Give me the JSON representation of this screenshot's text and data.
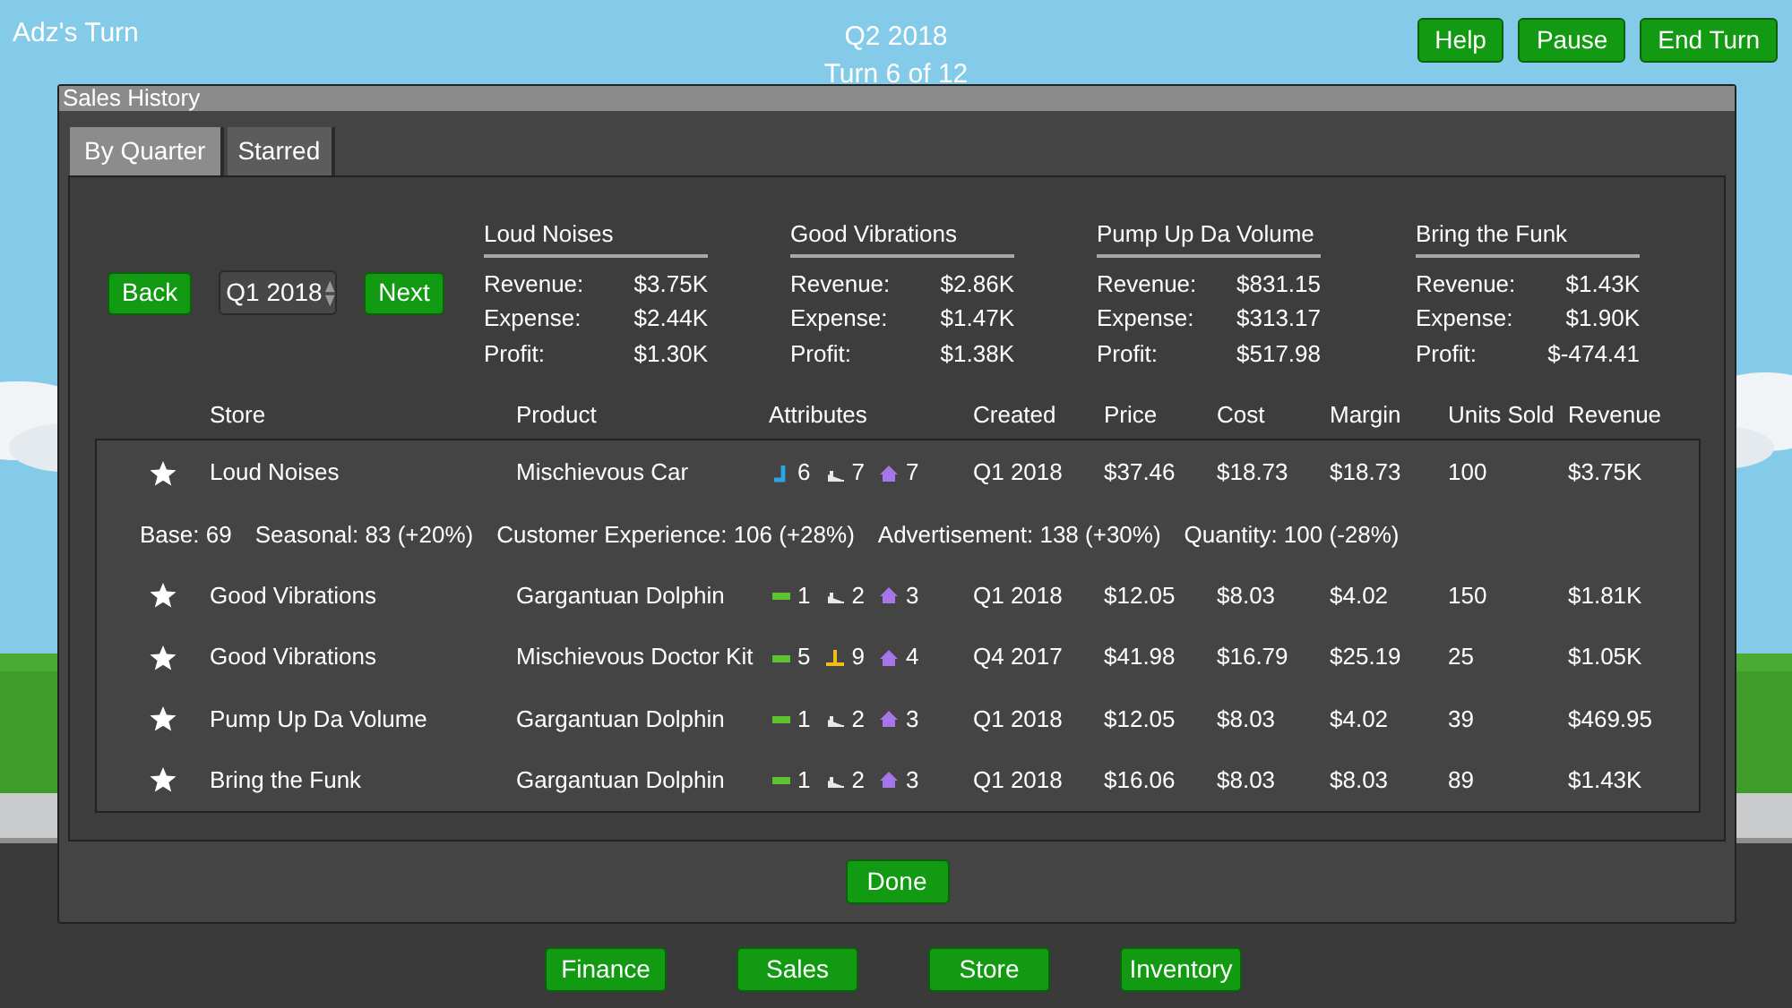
{
  "top_bar": {
    "player": "Adz's Turn",
    "quarter": "Q2 2018",
    "turn": "Turn 6 of 12",
    "buttons": [
      "Help",
      "Pause",
      "End Turn"
    ]
  },
  "dialog": {
    "title": "Sales History",
    "tabs": [
      {
        "label": "By Quarter",
        "selected": true
      },
      {
        "label": "Starred",
        "selected": false
      }
    ],
    "navigation": {
      "back": "Back",
      "quarter": "Q1 2018",
      "next": "Next"
    },
    "summaries": [
      {
        "store": "Loud Noises",
        "lines": [
          {
            "label": "Revenue:",
            "value": "$3.75K"
          },
          {
            "label": "Expense:",
            "value": "$2.44K"
          },
          {
            "label": "Profit:",
            "value": "$1.30K"
          }
        ]
      },
      {
        "store": "Good Vibrations",
        "lines": [
          {
            "label": "Revenue:",
            "value": "$2.86K"
          },
          {
            "label": "Expense:",
            "value": "$1.47K"
          },
          {
            "label": "Profit:",
            "value": "$1.38K"
          }
        ]
      },
      {
        "store": "Pump Up Da Volume",
        "lines": [
          {
            "label": "Revenue:",
            "value": "$831.15"
          },
          {
            "label": "Expense:",
            "value": "$313.17"
          },
          {
            "label": "Profit:",
            "value": "$517.98"
          }
        ]
      },
      {
        "store": "Bring the Funk",
        "lines": [
          {
            "label": "Revenue:",
            "value": "$1.43K"
          },
          {
            "label": "Expense:",
            "value": "$1.90K"
          },
          {
            "label": "Profit:",
            "value": "$-474.41"
          }
        ]
      }
    ],
    "table": {
      "columns": [
        "Store",
        "Product",
        "Attributes",
        "Created",
        "Price",
        "Cost",
        "Margin",
        "Units Sold",
        "Revenue"
      ],
      "rows": [
        {
          "starred": true,
          "store": "Loud Noises",
          "product": "Mischievous Car",
          "attributes": [
            {
              "kind": "hook",
              "value": "6"
            },
            {
              "kind": "ramp",
              "value": "7"
            },
            {
              "kind": "house",
              "value": "7"
            }
          ],
          "created": "Q1 2018",
          "price": "$37.46",
          "cost": "$18.73",
          "margin": "$18.73",
          "units_sold": "100",
          "revenue": "$3.75K",
          "details": [
            "Base: 69",
            "Seasonal: 83 (+20%)",
            "Customer Experience: 106 (+28%)",
            "Advertisement: 138 (+30%)",
            "Quantity: 100 (-28%)"
          ]
        },
        {
          "starred": true,
          "store": "Good Vibrations",
          "product": "Gargantuan Dolphin",
          "attributes": [
            {
              "kind": "bar",
              "value": "1"
            },
            {
              "kind": "ramp",
              "value": "2"
            },
            {
              "kind": "house",
              "value": "3"
            }
          ],
          "created": "Q1 2018",
          "price": "$12.05",
          "cost": "$8.03",
          "margin": "$4.02",
          "units_sold": "150",
          "revenue": "$1.81K"
        },
        {
          "starred": true,
          "store": "Good Vibrations",
          "product": "Mischievous Doctor Kit",
          "attributes": [
            {
              "kind": "bar",
              "value": "5"
            },
            {
              "kind": "tee",
              "value": "9"
            },
            {
              "kind": "house",
              "value": "4"
            }
          ],
          "created": "Q4 2017",
          "price": "$41.98",
          "cost": "$16.79",
          "margin": "$25.19",
          "units_sold": "25",
          "revenue": "$1.05K"
        },
        {
          "starred": true,
          "store": "Pump Up Da Volume",
          "product": "Gargantuan Dolphin",
          "attributes": [
            {
              "kind": "bar",
              "value": "1"
            },
            {
              "kind": "ramp",
              "value": "2"
            },
            {
              "kind": "house",
              "value": "3"
            }
          ],
          "created": "Q1 2018",
          "price": "$12.05",
          "cost": "$8.03",
          "margin": "$4.02",
          "units_sold": "39",
          "revenue": "$469.95"
        },
        {
          "starred": true,
          "store": "Bring the Funk",
          "product": "Gargantuan Dolphin",
          "attributes": [
            {
              "kind": "bar",
              "value": "1"
            },
            {
              "kind": "ramp",
              "value": "2"
            },
            {
              "kind": "house",
              "value": "3"
            }
          ],
          "created": "Q1 2018",
          "price": "$16.06",
          "cost": "$8.03",
          "margin": "$8.03",
          "units_sold": "89",
          "revenue": "$1.43K"
        }
      ]
    },
    "done": "Done"
  },
  "bottom_nav": [
    "Finance",
    "Sales",
    "Store",
    "Inventory"
  ]
}
